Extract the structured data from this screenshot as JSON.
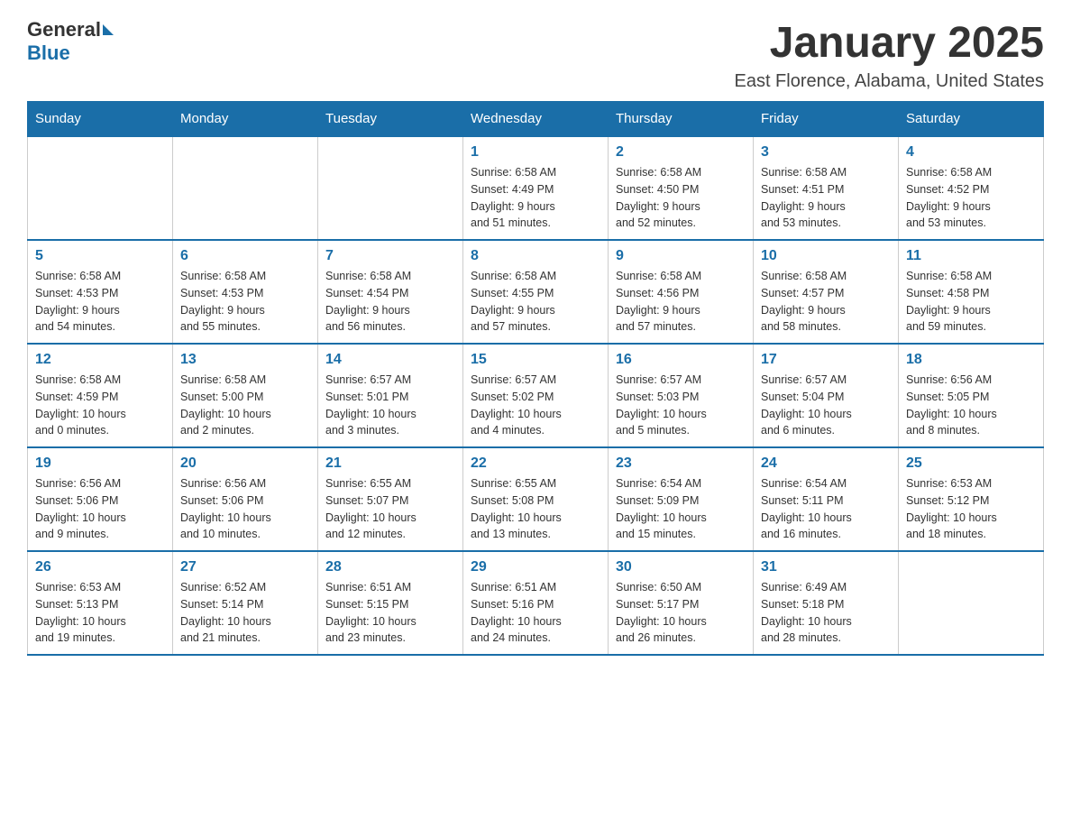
{
  "header": {
    "logo_general": "General",
    "logo_blue": "Blue",
    "month_title": "January 2025",
    "location": "East Florence, Alabama, United States"
  },
  "days_of_week": [
    "Sunday",
    "Monday",
    "Tuesday",
    "Wednesday",
    "Thursday",
    "Friday",
    "Saturday"
  ],
  "weeks": [
    [
      {
        "day": "",
        "info": ""
      },
      {
        "day": "",
        "info": ""
      },
      {
        "day": "",
        "info": ""
      },
      {
        "day": "1",
        "info": "Sunrise: 6:58 AM\nSunset: 4:49 PM\nDaylight: 9 hours\nand 51 minutes."
      },
      {
        "day": "2",
        "info": "Sunrise: 6:58 AM\nSunset: 4:50 PM\nDaylight: 9 hours\nand 52 minutes."
      },
      {
        "day": "3",
        "info": "Sunrise: 6:58 AM\nSunset: 4:51 PM\nDaylight: 9 hours\nand 53 minutes."
      },
      {
        "day": "4",
        "info": "Sunrise: 6:58 AM\nSunset: 4:52 PM\nDaylight: 9 hours\nand 53 minutes."
      }
    ],
    [
      {
        "day": "5",
        "info": "Sunrise: 6:58 AM\nSunset: 4:53 PM\nDaylight: 9 hours\nand 54 minutes."
      },
      {
        "day": "6",
        "info": "Sunrise: 6:58 AM\nSunset: 4:53 PM\nDaylight: 9 hours\nand 55 minutes."
      },
      {
        "day": "7",
        "info": "Sunrise: 6:58 AM\nSunset: 4:54 PM\nDaylight: 9 hours\nand 56 minutes."
      },
      {
        "day": "8",
        "info": "Sunrise: 6:58 AM\nSunset: 4:55 PM\nDaylight: 9 hours\nand 57 minutes."
      },
      {
        "day": "9",
        "info": "Sunrise: 6:58 AM\nSunset: 4:56 PM\nDaylight: 9 hours\nand 57 minutes."
      },
      {
        "day": "10",
        "info": "Sunrise: 6:58 AM\nSunset: 4:57 PM\nDaylight: 9 hours\nand 58 minutes."
      },
      {
        "day": "11",
        "info": "Sunrise: 6:58 AM\nSunset: 4:58 PM\nDaylight: 9 hours\nand 59 minutes."
      }
    ],
    [
      {
        "day": "12",
        "info": "Sunrise: 6:58 AM\nSunset: 4:59 PM\nDaylight: 10 hours\nand 0 minutes."
      },
      {
        "day": "13",
        "info": "Sunrise: 6:58 AM\nSunset: 5:00 PM\nDaylight: 10 hours\nand 2 minutes."
      },
      {
        "day": "14",
        "info": "Sunrise: 6:57 AM\nSunset: 5:01 PM\nDaylight: 10 hours\nand 3 minutes."
      },
      {
        "day": "15",
        "info": "Sunrise: 6:57 AM\nSunset: 5:02 PM\nDaylight: 10 hours\nand 4 minutes."
      },
      {
        "day": "16",
        "info": "Sunrise: 6:57 AM\nSunset: 5:03 PM\nDaylight: 10 hours\nand 5 minutes."
      },
      {
        "day": "17",
        "info": "Sunrise: 6:57 AM\nSunset: 5:04 PM\nDaylight: 10 hours\nand 6 minutes."
      },
      {
        "day": "18",
        "info": "Sunrise: 6:56 AM\nSunset: 5:05 PM\nDaylight: 10 hours\nand 8 minutes."
      }
    ],
    [
      {
        "day": "19",
        "info": "Sunrise: 6:56 AM\nSunset: 5:06 PM\nDaylight: 10 hours\nand 9 minutes."
      },
      {
        "day": "20",
        "info": "Sunrise: 6:56 AM\nSunset: 5:06 PM\nDaylight: 10 hours\nand 10 minutes."
      },
      {
        "day": "21",
        "info": "Sunrise: 6:55 AM\nSunset: 5:07 PM\nDaylight: 10 hours\nand 12 minutes."
      },
      {
        "day": "22",
        "info": "Sunrise: 6:55 AM\nSunset: 5:08 PM\nDaylight: 10 hours\nand 13 minutes."
      },
      {
        "day": "23",
        "info": "Sunrise: 6:54 AM\nSunset: 5:09 PM\nDaylight: 10 hours\nand 15 minutes."
      },
      {
        "day": "24",
        "info": "Sunrise: 6:54 AM\nSunset: 5:11 PM\nDaylight: 10 hours\nand 16 minutes."
      },
      {
        "day": "25",
        "info": "Sunrise: 6:53 AM\nSunset: 5:12 PM\nDaylight: 10 hours\nand 18 minutes."
      }
    ],
    [
      {
        "day": "26",
        "info": "Sunrise: 6:53 AM\nSunset: 5:13 PM\nDaylight: 10 hours\nand 19 minutes."
      },
      {
        "day": "27",
        "info": "Sunrise: 6:52 AM\nSunset: 5:14 PM\nDaylight: 10 hours\nand 21 minutes."
      },
      {
        "day": "28",
        "info": "Sunrise: 6:51 AM\nSunset: 5:15 PM\nDaylight: 10 hours\nand 23 minutes."
      },
      {
        "day": "29",
        "info": "Sunrise: 6:51 AM\nSunset: 5:16 PM\nDaylight: 10 hours\nand 24 minutes."
      },
      {
        "day": "30",
        "info": "Sunrise: 6:50 AM\nSunset: 5:17 PM\nDaylight: 10 hours\nand 26 minutes."
      },
      {
        "day": "31",
        "info": "Sunrise: 6:49 AM\nSunset: 5:18 PM\nDaylight: 10 hours\nand 28 minutes."
      },
      {
        "day": "",
        "info": ""
      }
    ]
  ]
}
